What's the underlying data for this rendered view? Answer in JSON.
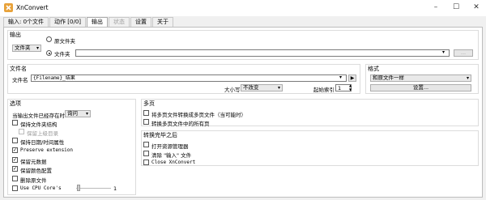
{
  "app": {
    "title": "XnConvert"
  },
  "tabs": [
    "输入: 0个文件",
    "动作 [0/0]",
    "输出",
    "状态",
    "设置",
    "关于"
  ],
  "output": {
    "group_label": "输出",
    "radio_original": "原文件夹",
    "radio_folder": "文件夹",
    "type_select": "文件夹",
    "path_value": "",
    "browse_label": "..."
  },
  "filename": {
    "group_label": "文件名",
    "label": "文件名",
    "value": "{Filename}_结果",
    "case_label": "大小写",
    "case_value": "不改变",
    "start_index_label": "起始索引",
    "start_index_value": "1"
  },
  "format": {
    "group_label": "格式",
    "select_value": "和原文件一样",
    "settings_label": "设置..."
  },
  "options": {
    "group_label": "选项",
    "exists_label": "当输出文件已经存在时",
    "exists_value": "询问",
    "items": [
      {
        "label": "保持文件夹结构",
        "checked": false,
        "disabled": false
      },
      {
        "label": "保留上级目录",
        "checked": false,
        "disabled": true
      },
      {
        "label": "保持日期/时间属性",
        "checked": false,
        "disabled": false
      },
      {
        "label": "Preserve extension",
        "checked": true,
        "disabled": false
      },
      {
        "label": "保留元数据",
        "checked": true,
        "disabled": false
      },
      {
        "label": "保留颜色配置",
        "checked": true,
        "disabled": false
      },
      {
        "label": "删除原文件",
        "checked": false,
        "disabled": false
      },
      {
        "label": "Use CPU Core's",
        "checked": false,
        "disabled": false
      }
    ],
    "cpu_value": "1"
  },
  "multipage": {
    "group_label": "多页",
    "items": [
      {
        "label": "将多页文件转换成多页文件（当可能时）",
        "checked": false
      },
      {
        "label": "转换多页文件中的所有页",
        "checked": false
      }
    ]
  },
  "after": {
    "group_label": "转换完毕之后",
    "items": [
      {
        "label": "打开资源管理器",
        "checked": false
      },
      {
        "label": "清除 \"输入\" 文件",
        "checked": false
      },
      {
        "label": "Close XnConvert",
        "checked": false
      }
    ]
  }
}
